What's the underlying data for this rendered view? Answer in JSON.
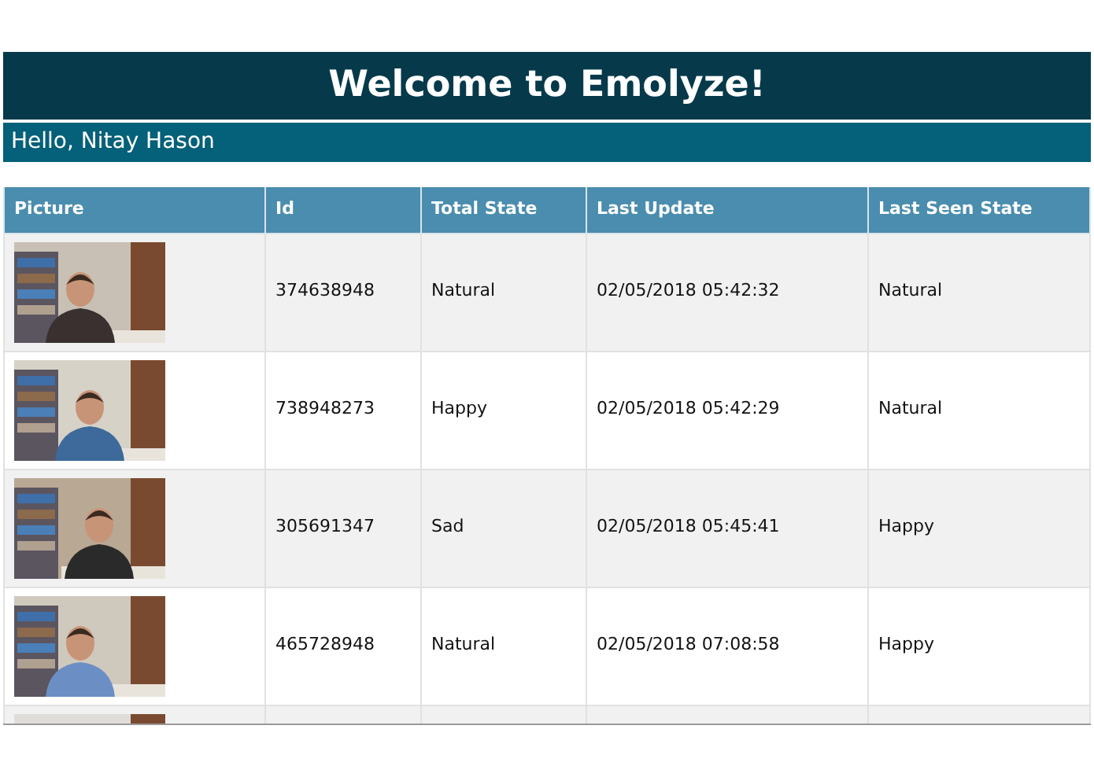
{
  "header": {
    "title": "Welcome to Emolyze!"
  },
  "greeting": "Hello, Nitay Hason",
  "table": {
    "columns": [
      "Picture",
      "Id",
      "Total State",
      "Last Update",
      "Last Seen State"
    ],
    "rows": [
      {
        "picture": {
          "kind": "picture"
        },
        "id": "374638948",
        "total_state": "Natural",
        "last_update": "02/05/2018 05:42:32",
        "last_seen_state": "Natural"
      },
      {
        "picture": {
          "kind": "picture"
        },
        "id": "738948273",
        "total_state": "Happy",
        "last_update": "02/05/2018 05:42:29",
        "last_seen_state": "Natural"
      },
      {
        "picture": {
          "kind": "picture"
        },
        "id": "305691347",
        "total_state": "Sad",
        "last_update": "02/05/2018 05:45:41",
        "last_seen_state": "Happy"
      },
      {
        "picture": {
          "kind": "picture"
        },
        "id": "465728948",
        "total_state": "Natural",
        "last_update": "02/05/2018 07:08:58",
        "last_seen_state": "Happy"
      },
      {
        "picture": {
          "kind": "picture"
        }
      }
    ]
  }
}
